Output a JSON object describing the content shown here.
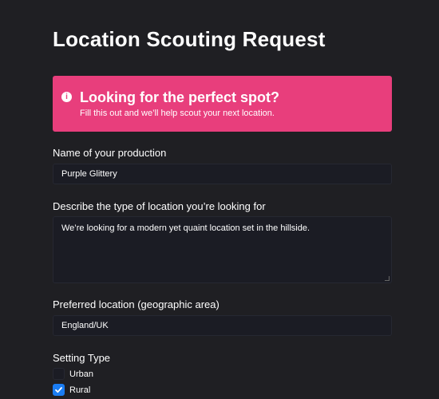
{
  "page": {
    "title": "Location Scouting Request"
  },
  "alert": {
    "icon": "info-icon",
    "title": "Looking for the perfect spot?",
    "text": "Fill this out and we’ll help scout your next location.",
    "color": "#e83e7c"
  },
  "form": {
    "production_name": {
      "label": "Name of your production",
      "value": "Purple Glittery"
    },
    "location_description": {
      "label": "Describe the type of location you’re looking for",
      "value": "We’re looking for a modern yet quaint location set in the hillside."
    },
    "preferred_location": {
      "label": "Preferred location (geographic area)",
      "value": "England/UK"
    },
    "setting_type": {
      "label": "Setting Type",
      "options": [
        {
          "label": "Urban",
          "checked": false
        },
        {
          "label": "Rural",
          "checked": true
        }
      ]
    }
  },
  "colors": {
    "background": "#1f1f23",
    "input_background": "#1b1c24",
    "checkbox_checked": "#1a7cf2"
  }
}
